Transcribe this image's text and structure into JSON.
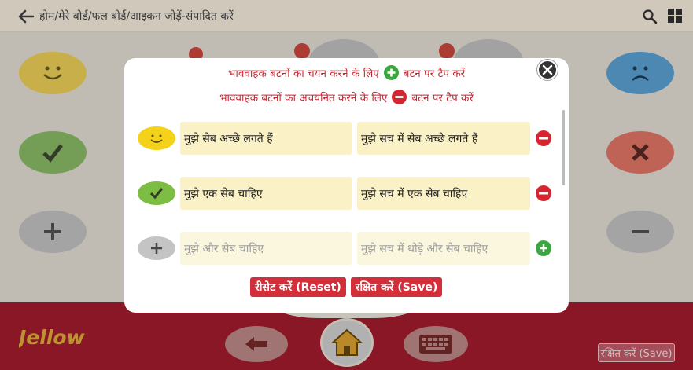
{
  "header": {
    "breadcrumb": "होम/मेरे बोर्ड/फल बोर्ड/आइकन जोड़ें-संपादित करें",
    "back_icon": "arrow-left-icon",
    "search_icon": "search-icon",
    "grid_icon": "grid-icon"
  },
  "dialog": {
    "hint_select_pre": "भाववाहक बटनों का चयन करने के लिए",
    "hint_select_post": "बटन पर टैप करें",
    "hint_deselect_pre": "भाववाहक बटनों का अचयनित करने के लिए",
    "hint_deselect_post": "बटन पर टैप करें",
    "rows": [
      {
        "icon": "smile-icon",
        "short": "मुझे सेब अच्छे लगते हैं",
        "long": "मुझे सच में सेब अच्छे लगते हैं",
        "action": "remove-icon"
      },
      {
        "icon": "check-icon",
        "short": "मुझे एक सेब चाहिए",
        "long": "मुझे सच में एक सेब चाहिए",
        "action": "remove-icon"
      },
      {
        "icon": "plus-icon",
        "short": "मुझे और सेब चाहिए",
        "long": "मुझे सच में थोड़े और सेब चाहिए",
        "action": "add-icon"
      }
    ],
    "reset_label": "रीसेट करें (Reset)",
    "save_label": "रक्षित करें (Save)"
  },
  "footer": {
    "logo_text": "Jellow",
    "save_label": "रक्षित करें (Save)"
  },
  "colors": {
    "accent_red": "#d32f3b",
    "footer_red": "#a81d2e",
    "field_yellow": "#fbf1c6",
    "add_green": "#3aa640"
  }
}
